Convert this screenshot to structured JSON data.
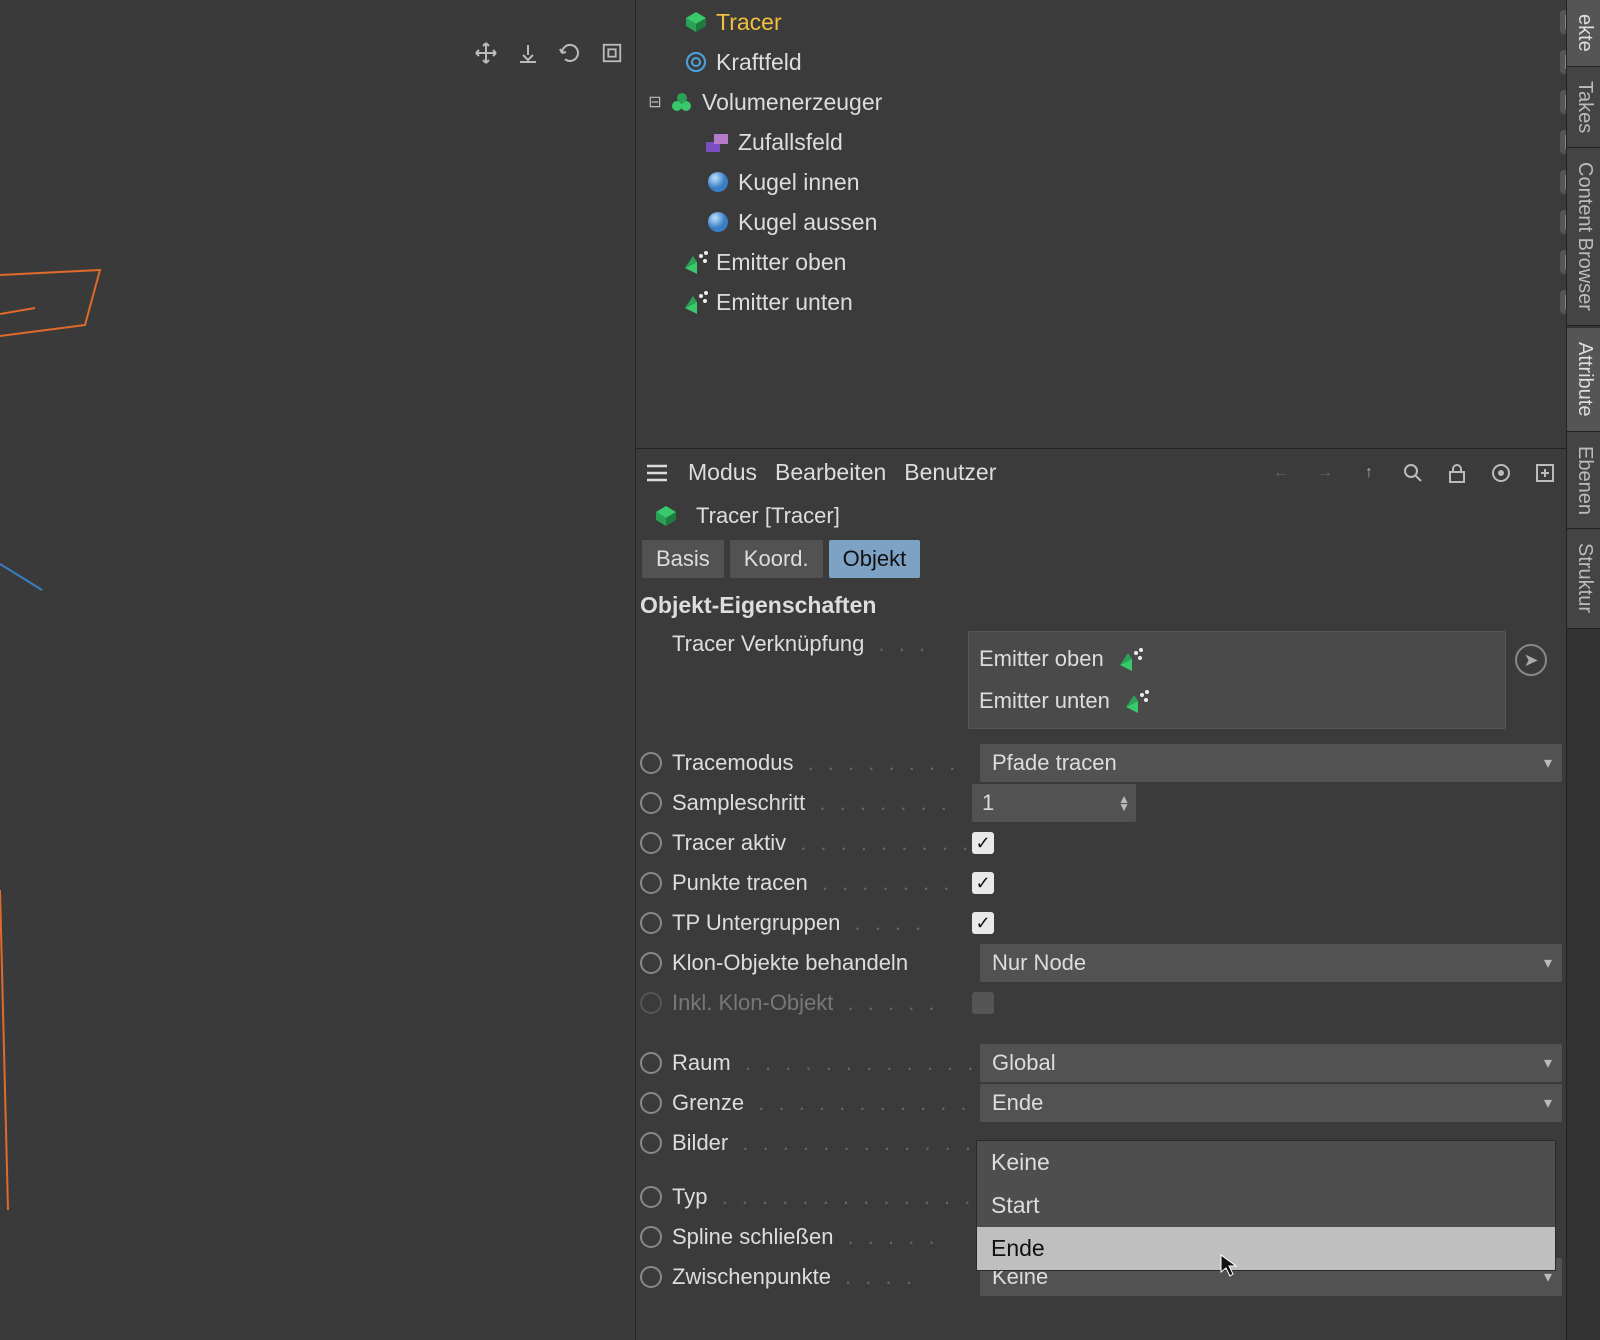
{
  "objects": {
    "tracer": "Tracer",
    "kraftfeld": "Kraftfeld",
    "volumenerzeuger": "Volumenerzeuger",
    "zufallsfeld": "Zufallsfeld",
    "kugel_innen": "Kugel innen",
    "kugel_aussen": "Kugel aussen",
    "emitter_oben": "Emitter oben",
    "emitter_unten": "Emitter unten"
  },
  "attr_menu": {
    "modus": "Modus",
    "bearbeiten": "Bearbeiten",
    "benutzer": "Benutzer"
  },
  "attr_title": "Tracer [Tracer]",
  "tabs": {
    "basis": "Basis",
    "koord": "Koord.",
    "objekt": "Objekt"
  },
  "section": "Objekt-Eigenschaften",
  "props": {
    "tracer_link": "Tracer Verknüpfung",
    "link1": "Emitter oben",
    "link2": "Emitter unten",
    "tracemodus": "Tracemodus",
    "tracemodus_val": "Pfade tracen",
    "sampleschritt": "Sampleschritt",
    "sampleschritt_val": "1",
    "tracer_aktiv": "Tracer aktiv",
    "punkte_tracen": "Punkte tracen",
    "tp_unter": "TP Untergruppen",
    "klon_beh": "Klon-Objekte behandeln",
    "klon_beh_val": "Nur Node",
    "inkl_klon": "Inkl. Klon-Objekt",
    "raum": "Raum",
    "raum_val": "Global",
    "grenze": "Grenze",
    "grenze_val": "Ende",
    "bilder": "Bilder",
    "typ": "Typ",
    "spline_close": "Spline schließen",
    "zwischenpunkte": "Zwischenpunkte",
    "zwischenpunkte_val": "Keine"
  },
  "grenze_opts": {
    "keine": "Keine",
    "start": "Start",
    "ende": "Ende"
  },
  "side_tabs": {
    "objekte": "ekte",
    "takes": "Takes",
    "content": "Content Browser",
    "attribute": "Attribute",
    "ebenen": "Ebenen",
    "struktur": "Struktur"
  }
}
